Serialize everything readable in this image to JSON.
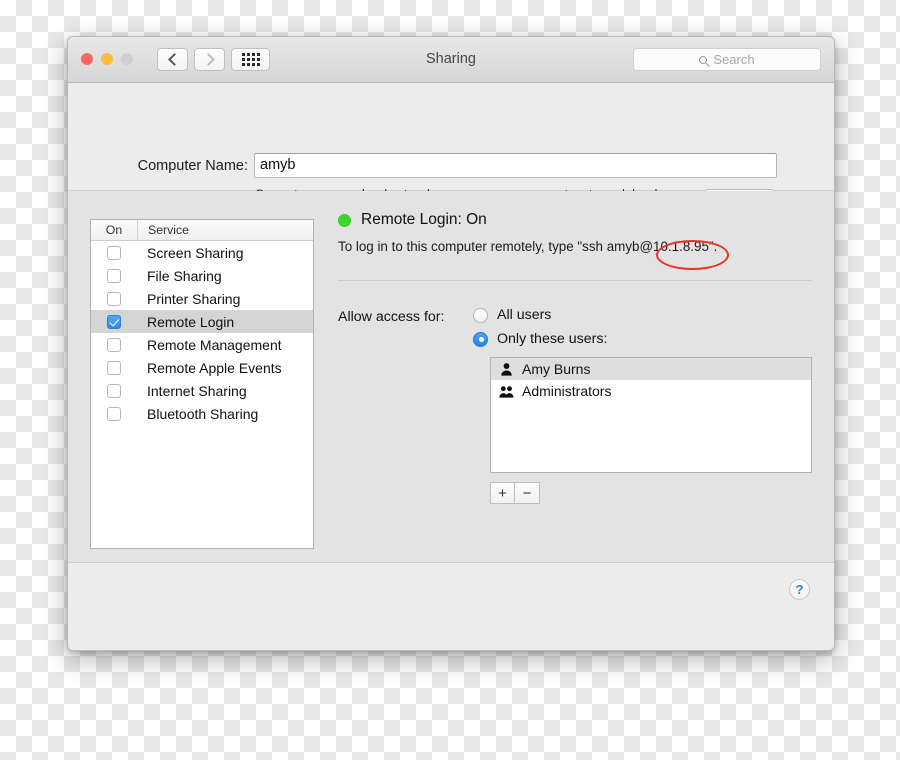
{
  "window": {
    "title": "Sharing",
    "traffic_lights": [
      "close",
      "minimize",
      "zoom"
    ],
    "nav_back": "back-icon",
    "nav_forward": "forward-icon",
    "grid_button": "show-all-icon",
    "search": {
      "placeholder": "Search",
      "value": "",
      "icon": "search-icon"
    }
  },
  "name_section": {
    "label": "Computer Name:",
    "value": "amyb",
    "help_text": "Computers on your local network can access your computer at: amyb.local",
    "edit_button": "Edit…"
  },
  "services": {
    "columns": [
      "On",
      "Service"
    ],
    "items": [
      {
        "label": "Screen Sharing",
        "on": false,
        "selected": false
      },
      {
        "label": "File Sharing",
        "on": false,
        "selected": false
      },
      {
        "label": "Printer Sharing",
        "on": false,
        "selected": false
      },
      {
        "label": "Remote Login",
        "on": true,
        "selected": true
      },
      {
        "label": "Remote Management",
        "on": false,
        "selected": false
      },
      {
        "label": "Remote Apple Events",
        "on": false,
        "selected": false
      },
      {
        "label": "Internet Sharing",
        "on": false,
        "selected": false
      },
      {
        "label": "Bluetooth Sharing",
        "on": false,
        "selected": false
      }
    ]
  },
  "detail": {
    "status_indicator": "on",
    "status_color": "#3cd72c",
    "status_text": "Remote Login: On",
    "ssh_instruction": "To log in to this computer remotely, type \"ssh amyb@10.1.8.95\".",
    "access_label": "Allow access for:",
    "radio_all_users": "All users",
    "radio_only_these": "Only these users:",
    "selected_radio": "only_these",
    "users": [
      {
        "name": "Amy Burns",
        "icon": "single-person-icon",
        "striped": true
      },
      {
        "name": "Administrators",
        "icon": "group-person-icon",
        "striped": false
      }
    ],
    "add_button": "+",
    "remove_button": "−"
  },
  "bottom": {
    "help_button": "?"
  },
  "annotation": {
    "shape": "ellipse",
    "color": "#ee3124",
    "highlights": "@10.1.8.95\""
  }
}
